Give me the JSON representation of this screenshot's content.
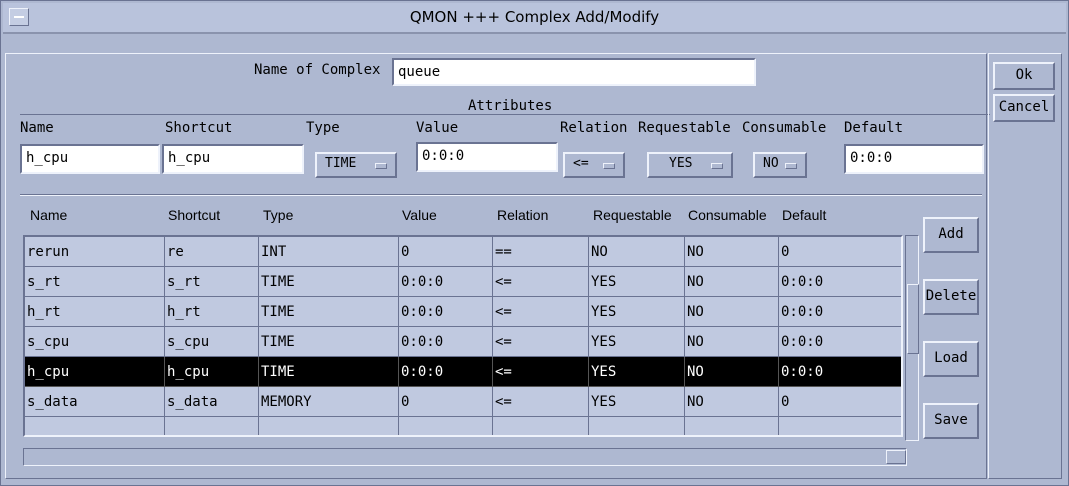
{
  "window": {
    "title": "QMON +++ Complex Add/Modify"
  },
  "complex": {
    "label": "Name of Complex",
    "value": "queue"
  },
  "attributes": {
    "group_title": "Attributes",
    "labels": {
      "name": "Name",
      "shortcut": "Shortcut",
      "type": "Type",
      "value": "Value",
      "relation": "Relation",
      "requestable": "Requestable",
      "consumable": "Consumable",
      "default": "Default"
    },
    "fields": {
      "name": "h_cpu",
      "shortcut": "h_cpu",
      "type": "TIME",
      "value": "0:0:0",
      "relation": "<=",
      "requestable": "YES",
      "consumable": "NO",
      "default": "0:0:0"
    }
  },
  "table": {
    "headers": [
      "Name",
      "Shortcut",
      "Type",
      "Value",
      "Relation",
      "Requestable",
      "Consumable",
      "Default"
    ],
    "rows": [
      [
        "rerun",
        "re",
        "INT",
        "0",
        "==",
        "NO",
        "NO",
        "0"
      ],
      [
        "s_rt",
        "s_rt",
        "TIME",
        "0:0:0",
        "<=",
        "YES",
        "NO",
        "0:0:0"
      ],
      [
        "h_rt",
        "h_rt",
        "TIME",
        "0:0:0",
        "<=",
        "YES",
        "NO",
        "0:0:0"
      ],
      [
        "s_cpu",
        "s_cpu",
        "TIME",
        "0:0:0",
        "<=",
        "YES",
        "NO",
        "0:0:0"
      ],
      [
        "h_cpu",
        "h_cpu",
        "TIME",
        "0:0:0",
        "<=",
        "YES",
        "NO",
        "0:0:0"
      ],
      [
        "s_data",
        "s_data",
        "MEMORY",
        "0",
        "<=",
        "YES",
        "NO",
        "0"
      ]
    ],
    "selected_row": 4
  },
  "buttons": {
    "add": "Add",
    "delete": "Delete",
    "load": "Load",
    "save": "Save",
    "ok": "Ok",
    "cancel": "Cancel"
  }
}
